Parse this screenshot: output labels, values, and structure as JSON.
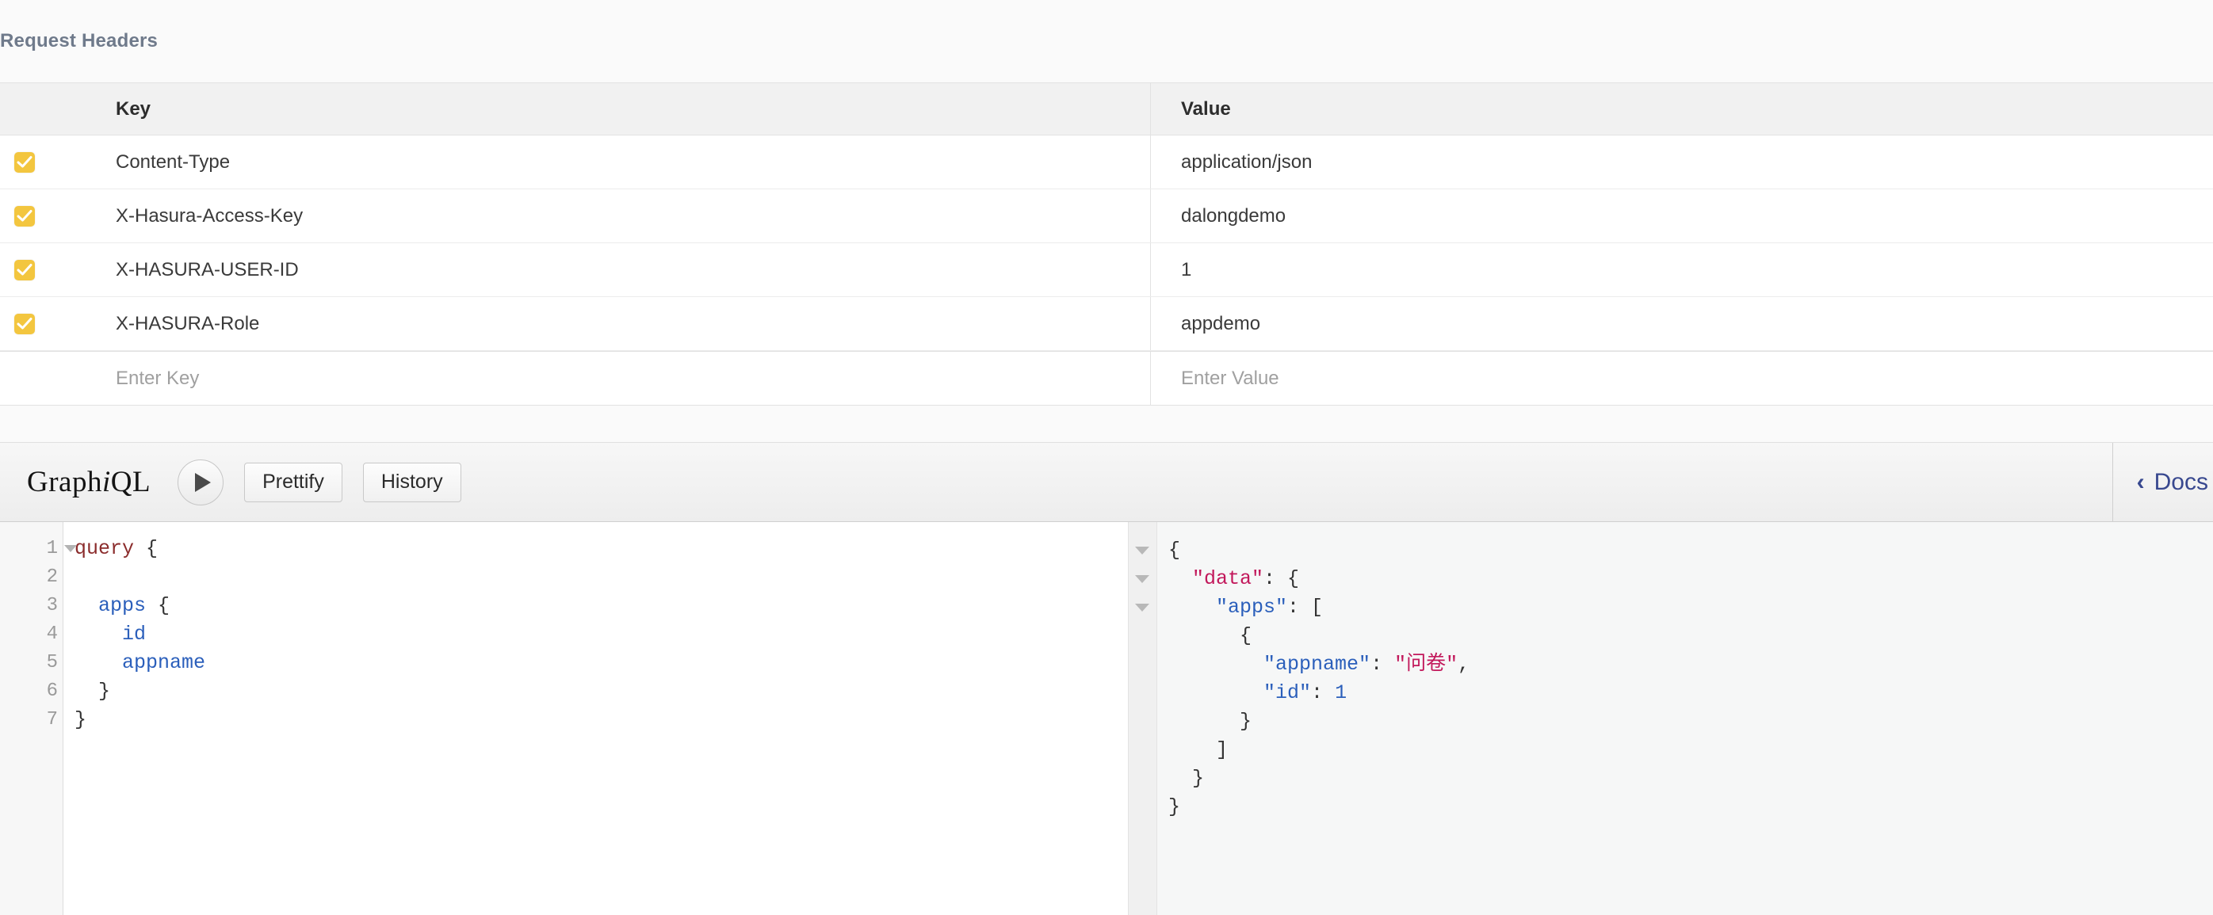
{
  "request_headers": {
    "section_title": "Request Headers",
    "columns": {
      "key": "Key",
      "value": "Value"
    },
    "rows": [
      {
        "checked": true,
        "key": "Content-Type",
        "value": "application/json"
      },
      {
        "checked": true,
        "key": "X-Hasura-Access-Key",
        "value": "dalongdemo"
      },
      {
        "checked": true,
        "key": "X-HASURA-USER-ID",
        "value": "1"
      },
      {
        "checked": true,
        "key": "X-HASURA-Role",
        "value": "appdemo"
      }
    ],
    "new_row": {
      "key_placeholder": "Enter Key",
      "value_placeholder": "Enter Value"
    },
    "checkbox_color": "#f3c63f"
  },
  "graphiql": {
    "logo_prefix": "Graph",
    "logo_italic": "i",
    "logo_suffix": "QL",
    "execute_label": "execute-query",
    "prettify_label": "Prettify",
    "history_label": "History",
    "docs_label": "Docs",
    "docs_chevron": "‹",
    "accent_color": "#38488f"
  },
  "query_editor": {
    "line_numbers": [
      "1",
      "2",
      "3",
      "4",
      "5",
      "6",
      "7"
    ],
    "fold_line": "1",
    "lines": [
      [
        {
          "t": "query",
          "c": "tok-kw"
        },
        {
          "t": " {",
          "c": "tok-pun"
        }
      ],
      [
        {
          "t": "",
          "c": "tok-pun"
        }
      ],
      [
        {
          "t": "  ",
          "c": "tok-pun"
        },
        {
          "t": "apps",
          "c": "tok-fld"
        },
        {
          "t": " {",
          "c": "tok-pun"
        }
      ],
      [
        {
          "t": "    ",
          "c": "tok-pun"
        },
        {
          "t": "id",
          "c": "tok-fld"
        }
      ],
      [
        {
          "t": "    ",
          "c": "tok-pun"
        },
        {
          "t": "appname",
          "c": "tok-fld"
        }
      ],
      [
        {
          "t": "  }",
          "c": "tok-pun"
        }
      ],
      [
        {
          "t": "}",
          "c": "tok-pun"
        }
      ]
    ],
    "raw": "query {\n\n  apps {\n    id\n    appname\n  }\n}"
  },
  "result_pane": {
    "fold_markers": 3,
    "lines": [
      [
        {
          "t": "{",
          "c": "j-pun"
        }
      ],
      [
        {
          "t": "  ",
          "c": "j-pun"
        },
        {
          "t": "\"data\"",
          "c": "j-top"
        },
        {
          "t": ": {",
          "c": "j-pun"
        }
      ],
      [
        {
          "t": "    ",
          "c": "j-pun"
        },
        {
          "t": "\"apps\"",
          "c": "j-key"
        },
        {
          "t": ": [",
          "c": "j-pun"
        }
      ],
      [
        {
          "t": "      {",
          "c": "j-pun"
        }
      ],
      [
        {
          "t": "        ",
          "c": "j-pun"
        },
        {
          "t": "\"appname\"",
          "c": "j-key"
        },
        {
          "t": ": ",
          "c": "j-pun"
        },
        {
          "t": "\"问卷\"",
          "c": "j-str"
        },
        {
          "t": ",",
          "c": "j-pun"
        }
      ],
      [
        {
          "t": "        ",
          "c": "j-pun"
        },
        {
          "t": "\"id\"",
          "c": "j-key"
        },
        {
          "t": ": ",
          "c": "j-pun"
        },
        {
          "t": "1",
          "c": "j-num"
        }
      ],
      [
        {
          "t": "      }",
          "c": "j-pun"
        }
      ],
      [
        {
          "t": "    ]",
          "c": "j-pun"
        }
      ],
      [
        {
          "t": "  }",
          "c": "j-pun"
        }
      ],
      [
        {
          "t": "}",
          "c": "j-pun"
        }
      ]
    ],
    "raw": "{\n  \"data\": {\n    \"apps\": [\n      {\n        \"appname\": \"问卷\",\n        \"id\": 1\n      }\n    ]\n  }\n}"
  }
}
